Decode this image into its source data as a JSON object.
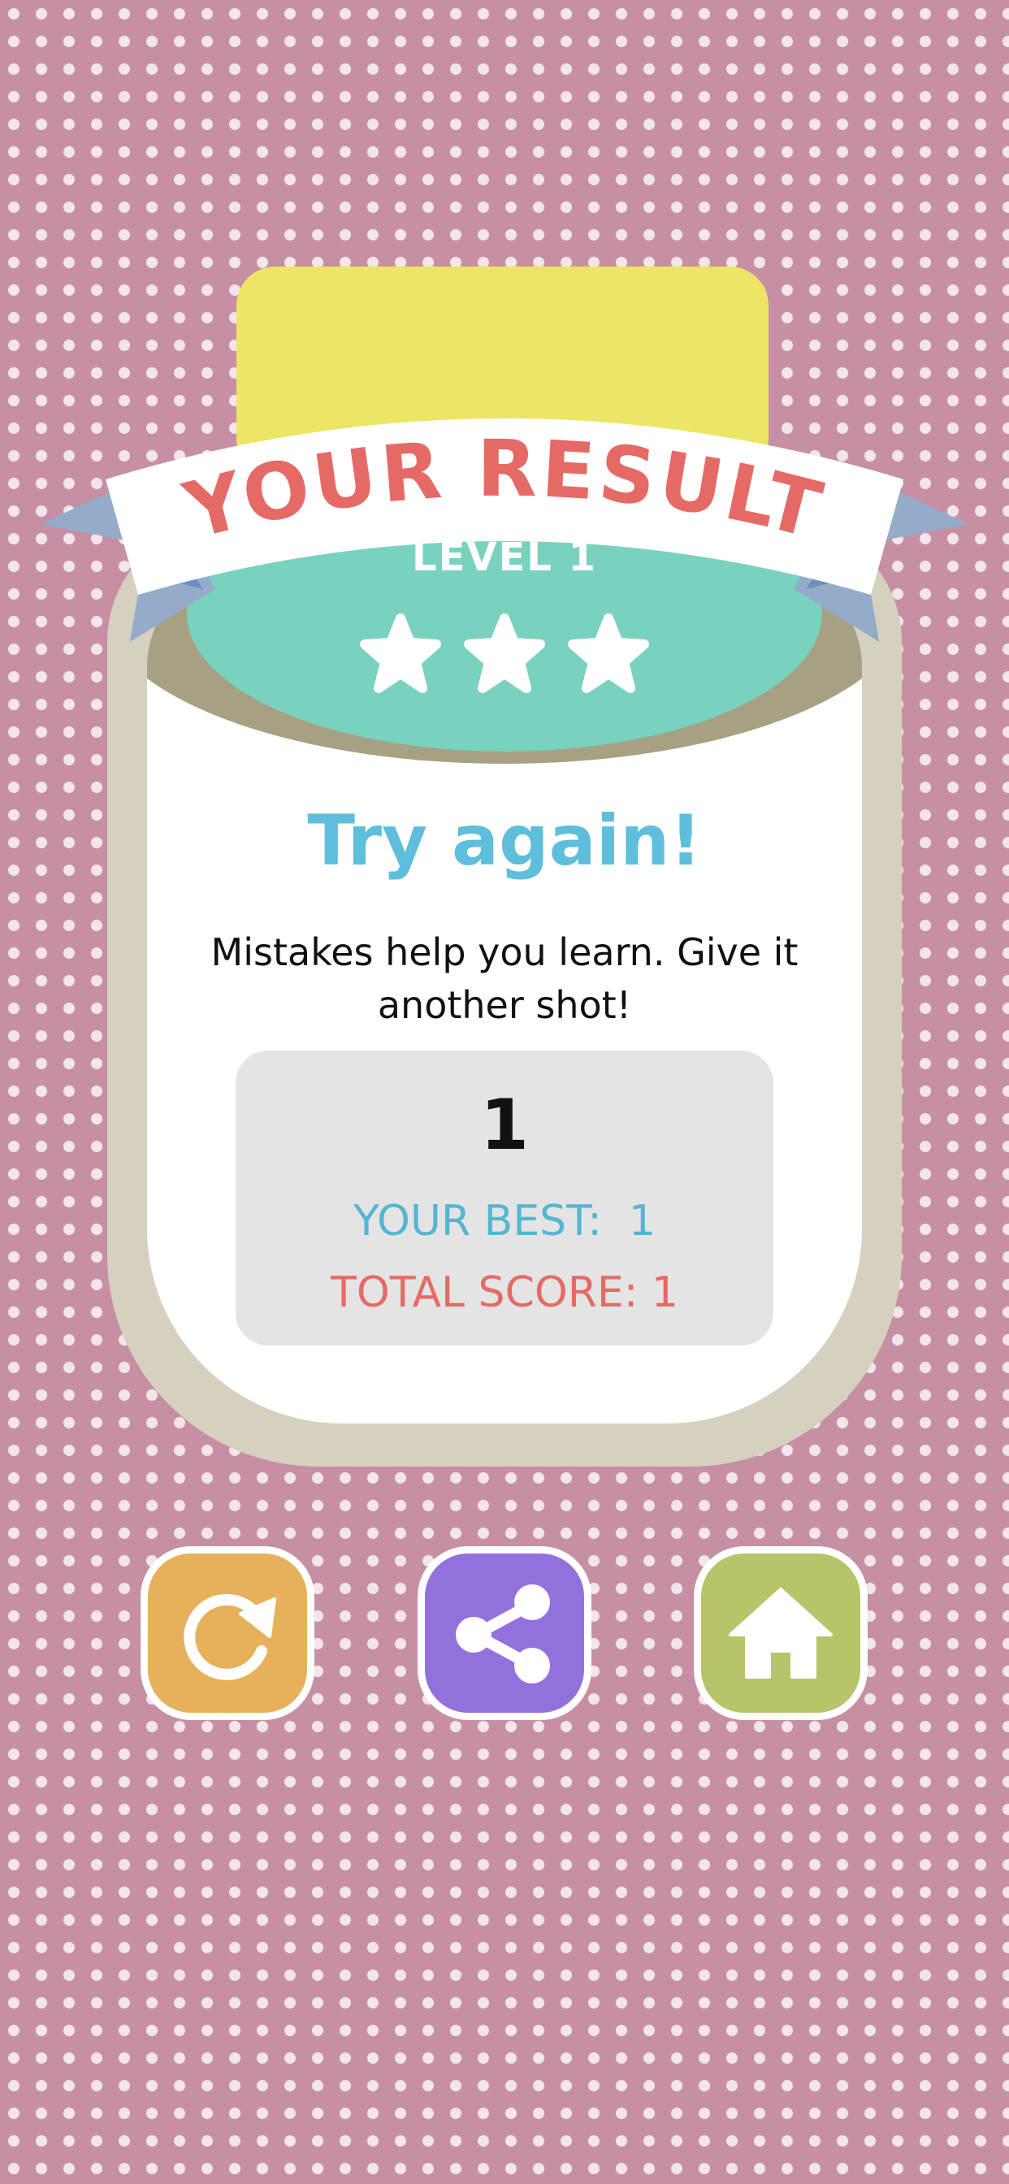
{
  "result": {
    "title": "YOUR RESULT",
    "level_label": "LEVEL 1",
    "stars_earned": 3,
    "stars_total": 3,
    "headline": "Try again!",
    "message_line1": "Mistakes help you learn. Give it",
    "message_line2": "another shot!",
    "score": "1",
    "best_label": "YOUR BEST:  1",
    "total_label": "TOTAL SCORE: 1"
  },
  "buttons": {
    "retry_icon": "retry-icon",
    "share_icon": "share-icon",
    "home_icon": "home-icon"
  },
  "colors": {
    "background": "#c68fa3",
    "dots": "#f2e6ea",
    "yellow_tab": "#ede565",
    "card_border": "#d6d0bf",
    "dome": "#79d2bd",
    "ribbon_text": "#e56a66",
    "ribbon_tail": "#94acc9",
    "headline": "#5ebedb",
    "best": "#54b6cf",
    "total": "#e56a66",
    "retry": "#e7b05b",
    "share": "#9172dd",
    "home": "#b8c36a"
  }
}
